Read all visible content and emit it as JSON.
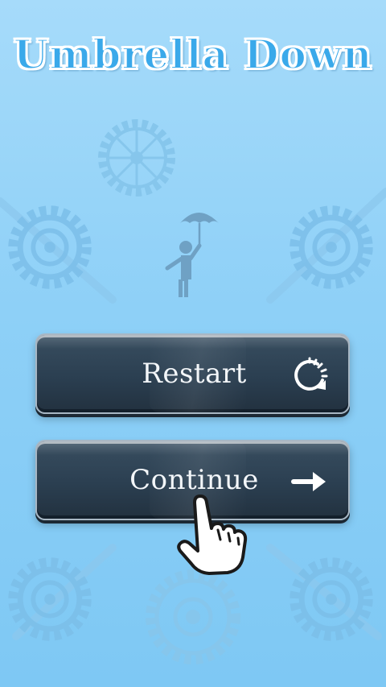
{
  "game": {
    "title": "Umbrella Down"
  },
  "menu": {
    "restart_label": "Restart",
    "restart_icon": "restart-icon",
    "continue_label": "Continue",
    "continue_icon": "arrow-right-icon"
  },
  "tutorial": {
    "hint_icon": "pointing-hand-icon"
  },
  "colors": {
    "background": "#8ed0f7",
    "title_fill": "#3aa9ea",
    "title_outline": "#ffffff",
    "button_fill": "#2b3f51",
    "button_text": "#f3f6f9",
    "decoration": "#7fbfe8"
  }
}
